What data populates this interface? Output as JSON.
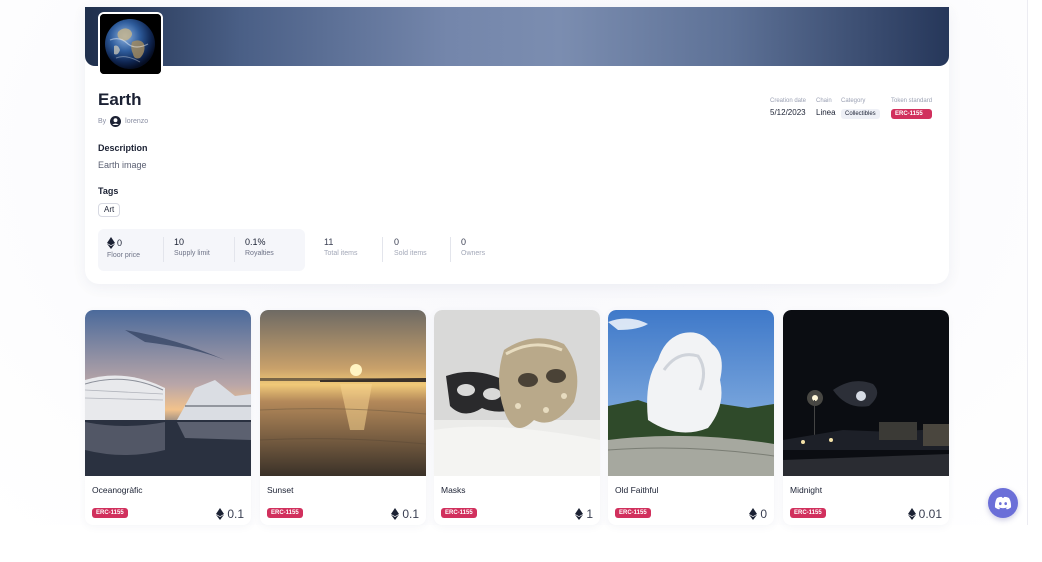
{
  "collection": {
    "title": "Earth",
    "by_prefix": "By",
    "author": "lorenzo",
    "description_label": "Description",
    "description": "Earth image",
    "tags_label": "Tags",
    "tags": [
      "Art"
    ],
    "meta": {
      "creation_date_label": "Creation date",
      "creation_date": "5/12/2023",
      "chain_label": "Chain",
      "chain": "Linea",
      "category_label": "Category",
      "category": "Collectibles",
      "token_standard_label": "Token standard",
      "token_standard": "ERC-1155"
    },
    "stats": {
      "floor_price": "0",
      "floor_price_label": "Floor price",
      "supply_limit": "10",
      "supply_limit_label": "Supply limit",
      "royalties": "0.1%",
      "royalties_label": "Royalties",
      "total_items": "11",
      "total_items_label": "Total items",
      "sold_items": "0",
      "sold_items_label": "Sold items",
      "owners": "0",
      "owners_label": "Owners"
    }
  },
  "items": [
    {
      "name": "Oceanogràfic",
      "standard": "ERC-1155",
      "price": "0.1"
    },
    {
      "name": "Sunset",
      "standard": "ERC-1155",
      "price": "0.1"
    },
    {
      "name": "Masks",
      "standard": "ERC-1155",
      "price": "1"
    },
    {
      "name": "Old Faithful",
      "standard": "ERC-1155",
      "price": "0"
    },
    {
      "name": "Midnight",
      "standard": "ERC-1155",
      "price": "0.01"
    }
  ],
  "colors": {
    "accent_pink": "#d1305d",
    "discord": "#6b6fd8"
  },
  "icons": {
    "price": "ethereum-icon",
    "author": "user-avatar-icon",
    "support": "discord-icon"
  }
}
